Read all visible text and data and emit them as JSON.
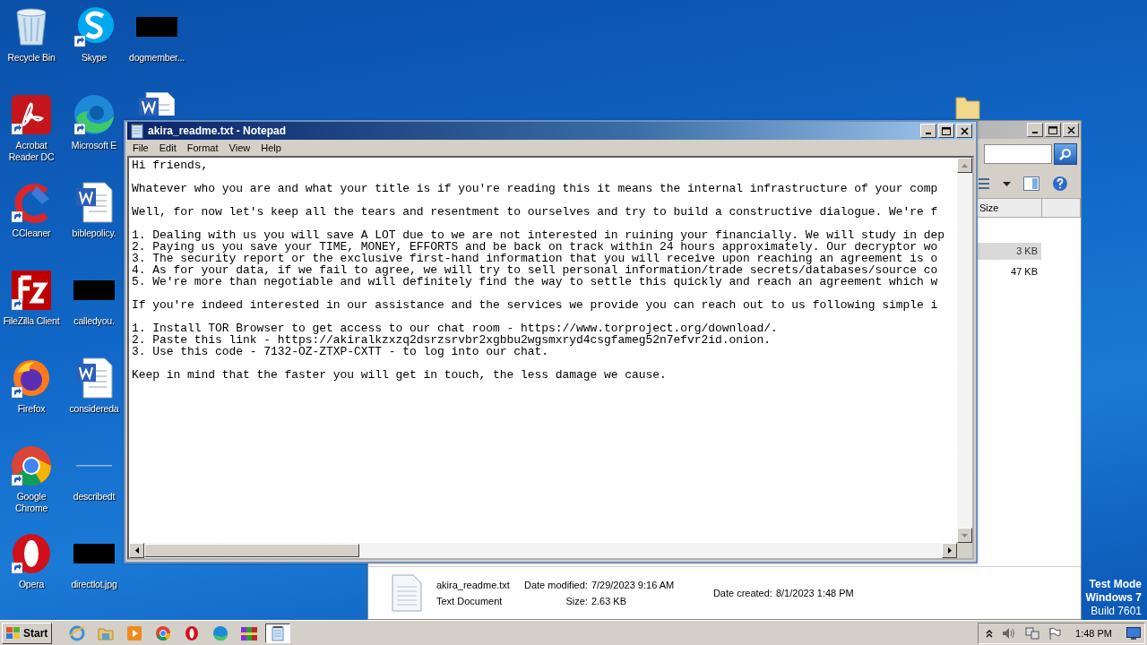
{
  "desktop": {
    "icons": [
      {
        "kind": "recycle-bin",
        "label": "Recycle Bin"
      },
      {
        "kind": "acrobat",
        "label": "Acrobat Reader DC"
      },
      {
        "kind": "ccleaner",
        "label": "CCleaner"
      },
      {
        "kind": "filezilla",
        "label": "FileZilla Client"
      },
      {
        "kind": "firefox",
        "label": "Firefox"
      },
      {
        "kind": "chrome",
        "label": "Google Chrome"
      },
      {
        "kind": "opera",
        "label": "Opera"
      },
      {
        "kind": "skype",
        "label": "Skype"
      },
      {
        "kind": "edge",
        "label": "Microsoft E"
      },
      {
        "kind": "word",
        "label": "biblepolicy."
      },
      {
        "kind": "redacted",
        "label": "calledyou."
      },
      {
        "kind": "word",
        "label": "considereda"
      },
      {
        "kind": "line",
        "label": "describedt"
      },
      {
        "kind": "redacted",
        "label": "directlot.jpg"
      },
      {
        "kind": "redacted",
        "label": "dogmember..."
      },
      {
        "kind": "word-top"
      }
    ],
    "os_notice": [
      "Test Mode",
      "Windows 7",
      "Build 7601"
    ]
  },
  "explorer": {
    "size_header": "Size",
    "rows": [
      {
        "size": "3 KB",
        "selected": true
      },
      {
        "size": "47 KB",
        "selected": false
      }
    ],
    "details": {
      "name": "akira_readme.txt",
      "type": "Text Document",
      "props": [
        {
          "label": "Date modified:",
          "value": "7/29/2023 9:16 AM"
        },
        {
          "label": "Size:",
          "value": "2.63 KB"
        },
        {
          "label": "Date created:",
          "value": "8/1/2023 1:48 PM"
        }
      ]
    }
  },
  "notepad": {
    "title": "akira_readme.txt - Notepad",
    "menu": [
      "File",
      "Edit",
      "Format",
      "View",
      "Help"
    ],
    "paragraphs": [
      [
        "Hi friends,"
      ],
      [
        "Whatever who you are and what your title is if you're reading this it means the internal infrastructure of your comp"
      ],
      [
        "Well, for now let's keep all the tears and resentment to ourselves and try to build a constructive dialogue. We're f"
      ],
      [
        "1. Dealing with us you will save A LOT due to we are not interested in ruining your financially. We will study in dep",
        "2. Paying us you save your TIME, MONEY, EFFORTS and be back on track within 24 hours approximately. Our decryptor wo",
        "3. The security report or the exclusive first-hand information that you will receive upon reaching an agreement is o",
        "4. As for your data, if we fail to agree, we will try to sell personal information/trade secrets/databases/source co",
        "5. We're more than negotiable and will definitely find the way to settle this quickly and reach an agreement which w"
      ],
      [
        "If you're indeed interested in our assistance and the services we provide you can reach out to us following simple i"
      ],
      [
        "1. Install TOR Browser to get access to our chat room - https://www.torproject.org/download/.",
        "2. Paste this link - https://akiralkzxzq2dsrzsrvbr2xgbbu2wgsmxryd4csgfameg52n7efvr2id.onion.",
        "3. Use this code - 7132-OZ-ZTXP-CXTT - to log into our chat."
      ],
      [
        "Keep in mind that the faster you will get in touch, the less damage we cause."
      ]
    ]
  },
  "taskbar": {
    "start": "Start",
    "apps": [
      {
        "kind": "ie",
        "selected": false
      },
      {
        "kind": "explorer",
        "selected": false
      },
      {
        "kind": "media",
        "selected": false
      },
      {
        "kind": "chrome",
        "selected": false
      },
      {
        "kind": "opera",
        "selected": false
      },
      {
        "kind": "edge",
        "selected": false
      },
      {
        "kind": "winrar",
        "selected": false
      },
      {
        "kind": "notepad",
        "selected": true
      }
    ],
    "clock": "1:48 PM"
  }
}
